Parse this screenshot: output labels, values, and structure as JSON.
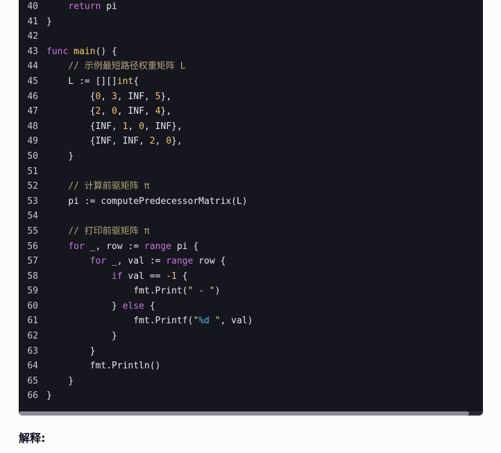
{
  "code": {
    "lines": [
      {
        "no": "40",
        "tokens": [
          {
            "t": "    ",
            "c": "plain"
          },
          {
            "t": "return",
            "c": "kw"
          },
          {
            "t": " pi",
            "c": "plain"
          }
        ]
      },
      {
        "no": "41",
        "tokens": [
          {
            "t": "}",
            "c": "plain"
          }
        ]
      },
      {
        "no": "42",
        "tokens": []
      },
      {
        "no": "43",
        "tokens": [
          {
            "t": "func",
            "c": "kw"
          },
          {
            "t": " ",
            "c": "plain"
          },
          {
            "t": "main",
            "c": "fn"
          },
          {
            "t": "() {",
            "c": "plain"
          }
        ]
      },
      {
        "no": "44",
        "tokens": [
          {
            "t": "    // 示例最短路径权重矩阵 L",
            "c": "comment"
          }
        ]
      },
      {
        "no": "45",
        "tokens": [
          {
            "t": "    L := [][]",
            "c": "plain"
          },
          {
            "t": "int",
            "c": "type"
          },
          {
            "t": "{",
            "c": "plain"
          }
        ]
      },
      {
        "no": "46",
        "tokens": [
          {
            "t": "        {",
            "c": "plain"
          },
          {
            "t": "0",
            "c": "num"
          },
          {
            "t": ", ",
            "c": "plain"
          },
          {
            "t": "3",
            "c": "num"
          },
          {
            "t": ", INF, ",
            "c": "plain"
          },
          {
            "t": "5",
            "c": "num"
          },
          {
            "t": "},",
            "c": "plain"
          }
        ]
      },
      {
        "no": "47",
        "tokens": [
          {
            "t": "        {",
            "c": "plain"
          },
          {
            "t": "2",
            "c": "num"
          },
          {
            "t": ", ",
            "c": "plain"
          },
          {
            "t": "0",
            "c": "num"
          },
          {
            "t": ", INF, ",
            "c": "plain"
          },
          {
            "t": "4",
            "c": "num"
          },
          {
            "t": "},",
            "c": "plain"
          }
        ]
      },
      {
        "no": "48",
        "tokens": [
          {
            "t": "        {INF, ",
            "c": "plain"
          },
          {
            "t": "1",
            "c": "num"
          },
          {
            "t": ", ",
            "c": "plain"
          },
          {
            "t": "0",
            "c": "num"
          },
          {
            "t": ", INF},",
            "c": "plain"
          }
        ]
      },
      {
        "no": "49",
        "tokens": [
          {
            "t": "        {INF, INF, ",
            "c": "plain"
          },
          {
            "t": "2",
            "c": "num"
          },
          {
            "t": ", ",
            "c": "plain"
          },
          {
            "t": "0",
            "c": "num"
          },
          {
            "t": "},",
            "c": "plain"
          }
        ]
      },
      {
        "no": "50",
        "tokens": [
          {
            "t": "    }",
            "c": "plain"
          }
        ]
      },
      {
        "no": "51",
        "tokens": []
      },
      {
        "no": "52",
        "tokens": [
          {
            "t": "    // 计算前驱矩阵 π",
            "c": "comment"
          }
        ]
      },
      {
        "no": "53",
        "tokens": [
          {
            "t": "    pi := computePredecessorMatrix(L)",
            "c": "plain"
          }
        ]
      },
      {
        "no": "54",
        "tokens": []
      },
      {
        "no": "55",
        "tokens": [
          {
            "t": "    // 打印前驱矩阵 π",
            "c": "comment"
          }
        ]
      },
      {
        "no": "56",
        "tokens": [
          {
            "t": "    ",
            "c": "plain"
          },
          {
            "t": "for",
            "c": "kw"
          },
          {
            "t": " _, row := ",
            "c": "plain"
          },
          {
            "t": "range",
            "c": "kw"
          },
          {
            "t": " pi {",
            "c": "plain"
          }
        ]
      },
      {
        "no": "57",
        "tokens": [
          {
            "t": "        ",
            "c": "plain"
          },
          {
            "t": "for",
            "c": "kw"
          },
          {
            "t": " _, val := ",
            "c": "plain"
          },
          {
            "t": "range",
            "c": "kw"
          },
          {
            "t": " row {",
            "c": "plain"
          }
        ]
      },
      {
        "no": "58",
        "tokens": [
          {
            "t": "            ",
            "c": "plain"
          },
          {
            "t": "if",
            "c": "kw"
          },
          {
            "t": " val == ",
            "c": "plain"
          },
          {
            "t": "-1",
            "c": "num"
          },
          {
            "t": " {",
            "c": "plain"
          }
        ]
      },
      {
        "no": "59",
        "tokens": [
          {
            "t": "                fmt.Print(",
            "c": "plain"
          },
          {
            "t": "\" - \"",
            "c": "str"
          },
          {
            "t": ")",
            "c": "plain"
          }
        ]
      },
      {
        "no": "60",
        "tokens": [
          {
            "t": "            } ",
            "c": "plain"
          },
          {
            "t": "else",
            "c": "kw"
          },
          {
            "t": " {",
            "c": "plain"
          }
        ]
      },
      {
        "no": "61",
        "tokens": [
          {
            "t": "                fmt.Printf(",
            "c": "plain"
          },
          {
            "t": "\"",
            "c": "str"
          },
          {
            "t": "%d",
            "c": "fmt"
          },
          {
            "t": " \"",
            "c": "str"
          },
          {
            "t": ", val)",
            "c": "plain"
          }
        ]
      },
      {
        "no": "62",
        "tokens": [
          {
            "t": "            }",
            "c": "plain"
          }
        ]
      },
      {
        "no": "63",
        "tokens": [
          {
            "t": "        }",
            "c": "plain"
          }
        ]
      },
      {
        "no": "64",
        "tokens": [
          {
            "t": "        fmt.Println()",
            "c": "plain"
          }
        ]
      },
      {
        "no": "65",
        "tokens": [
          {
            "t": "    }",
            "c": "plain"
          }
        ]
      },
      {
        "no": "66",
        "tokens": [
          {
            "t": "}",
            "c": "plain"
          }
        ]
      }
    ]
  },
  "explanation": {
    "heading": "解释:"
  },
  "colors": {
    "code_background": "#16161e",
    "keyword": "#c678dd",
    "function": "#f2d36b",
    "number": "#f4c46a",
    "string": "#b8e67a",
    "comment": "#b5a77c"
  }
}
